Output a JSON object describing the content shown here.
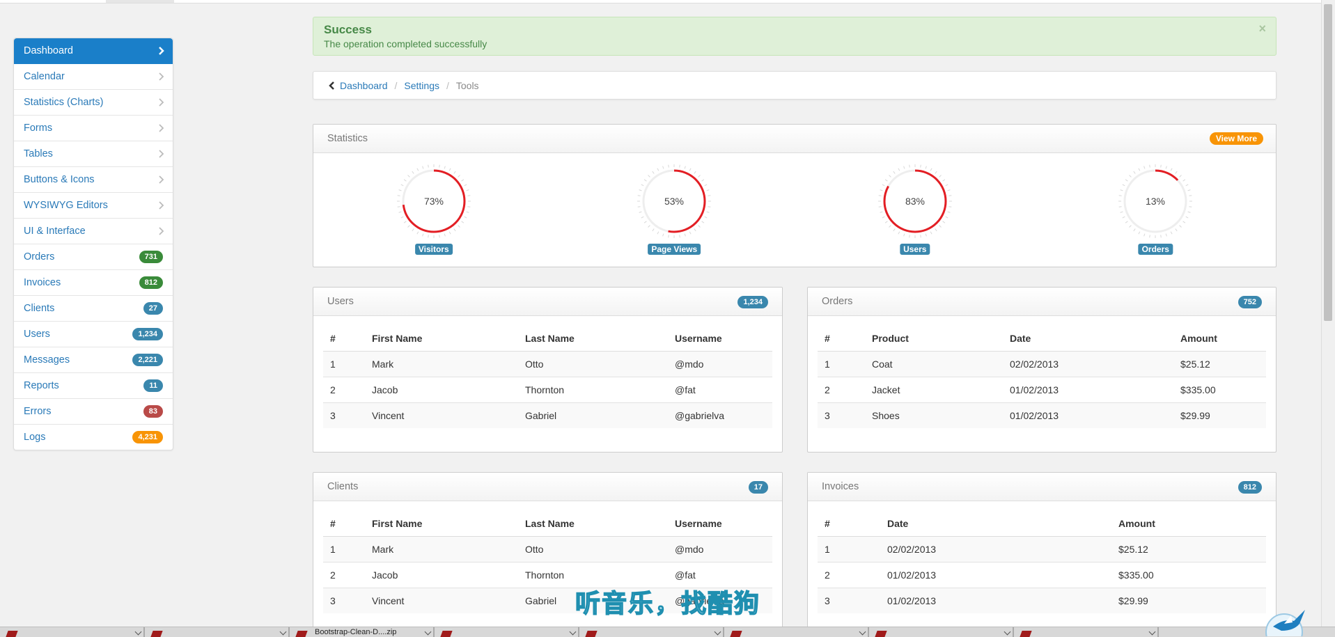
{
  "sidebar": {
    "items": [
      {
        "label": "Dashboard",
        "active": true
      },
      {
        "label": "Calendar"
      },
      {
        "label": "Statistics (Charts)"
      },
      {
        "label": "Forms"
      },
      {
        "label": "Tables"
      },
      {
        "label": "Buttons & Icons"
      },
      {
        "label": "WYSIWYG Editors"
      },
      {
        "label": "UI & Interface"
      },
      {
        "label": "Orders",
        "badge": "731",
        "badge_color": "green"
      },
      {
        "label": "Invoices",
        "badge": "812",
        "badge_color": "green"
      },
      {
        "label": "Clients",
        "badge": "27",
        "badge_color": "blue"
      },
      {
        "label": "Users",
        "badge": "1,234",
        "badge_color": "blue"
      },
      {
        "label": "Messages",
        "badge": "2,221",
        "badge_color": "blue"
      },
      {
        "label": "Reports",
        "badge": "11",
        "badge_color": "blue"
      },
      {
        "label": "Errors",
        "badge": "83",
        "badge_color": "red"
      },
      {
        "label": "Logs",
        "badge": "4,231",
        "badge_color": "orange"
      }
    ]
  },
  "alert": {
    "title": "Success",
    "message": "The operation completed successfully",
    "close": "×"
  },
  "breadcrumb": {
    "items": [
      "Dashboard",
      "Settings"
    ],
    "current": "Tools"
  },
  "statistics": {
    "title": "Statistics",
    "view_more": "View More",
    "gauges": [
      {
        "value": 73,
        "text": "73%",
        "label": "Visitors"
      },
      {
        "value": 53,
        "text": "53%",
        "label": "Page Views"
      },
      {
        "value": 83,
        "text": "83%",
        "label": "Users"
      },
      {
        "value": 13,
        "text": "13%",
        "label": "Orders"
      }
    ],
    "gauge_color": "#e31e24"
  },
  "users_panel": {
    "title": "Users",
    "badge": "1,234",
    "headers": [
      "#",
      "First Name",
      "Last Name",
      "Username"
    ],
    "rows": [
      [
        "1",
        "Mark",
        "Otto",
        "@mdo"
      ],
      [
        "2",
        "Jacob",
        "Thornton",
        "@fat"
      ],
      [
        "3",
        "Vincent",
        "Gabriel",
        "@gabrielva"
      ]
    ]
  },
  "orders_panel": {
    "title": "Orders",
    "badge": "752",
    "headers": [
      "#",
      "Product",
      "Date",
      "Amount"
    ],
    "rows": [
      [
        "1",
        "Coat",
        "02/02/2013",
        "$25.12"
      ],
      [
        "2",
        "Jacket",
        "01/02/2013",
        "$335.00"
      ],
      [
        "3",
        "Shoes",
        "01/02/2013",
        "$29.99"
      ]
    ]
  },
  "clients_panel": {
    "title": "Clients",
    "badge": "17",
    "headers": [
      "#",
      "First Name",
      "Last Name",
      "Username"
    ],
    "rows": [
      [
        "1",
        "Mark",
        "Otto",
        "@mdo"
      ],
      [
        "2",
        "Jacob",
        "Thornton",
        "@fat"
      ],
      [
        "3",
        "Vincent",
        "Gabriel",
        "@gabrielva"
      ]
    ]
  },
  "invoices_panel": {
    "title": "Invoices",
    "badge": "812",
    "headers": [
      "#",
      "Date",
      "Amount"
    ],
    "rows": [
      [
        "1",
        "02/02/2013",
        "$25.12"
      ],
      [
        "2",
        "01/02/2013",
        "$335.00"
      ],
      [
        "3",
        "01/02/2013",
        "$29.99"
      ]
    ]
  },
  "overlay": {
    "text": "听音乐，找酷狗"
  },
  "taskbar": {
    "tasks": [
      "",
      "",
      "Bootstrap-Clean-D....zip",
      "",
      "",
      "",
      "",
      ""
    ]
  }
}
